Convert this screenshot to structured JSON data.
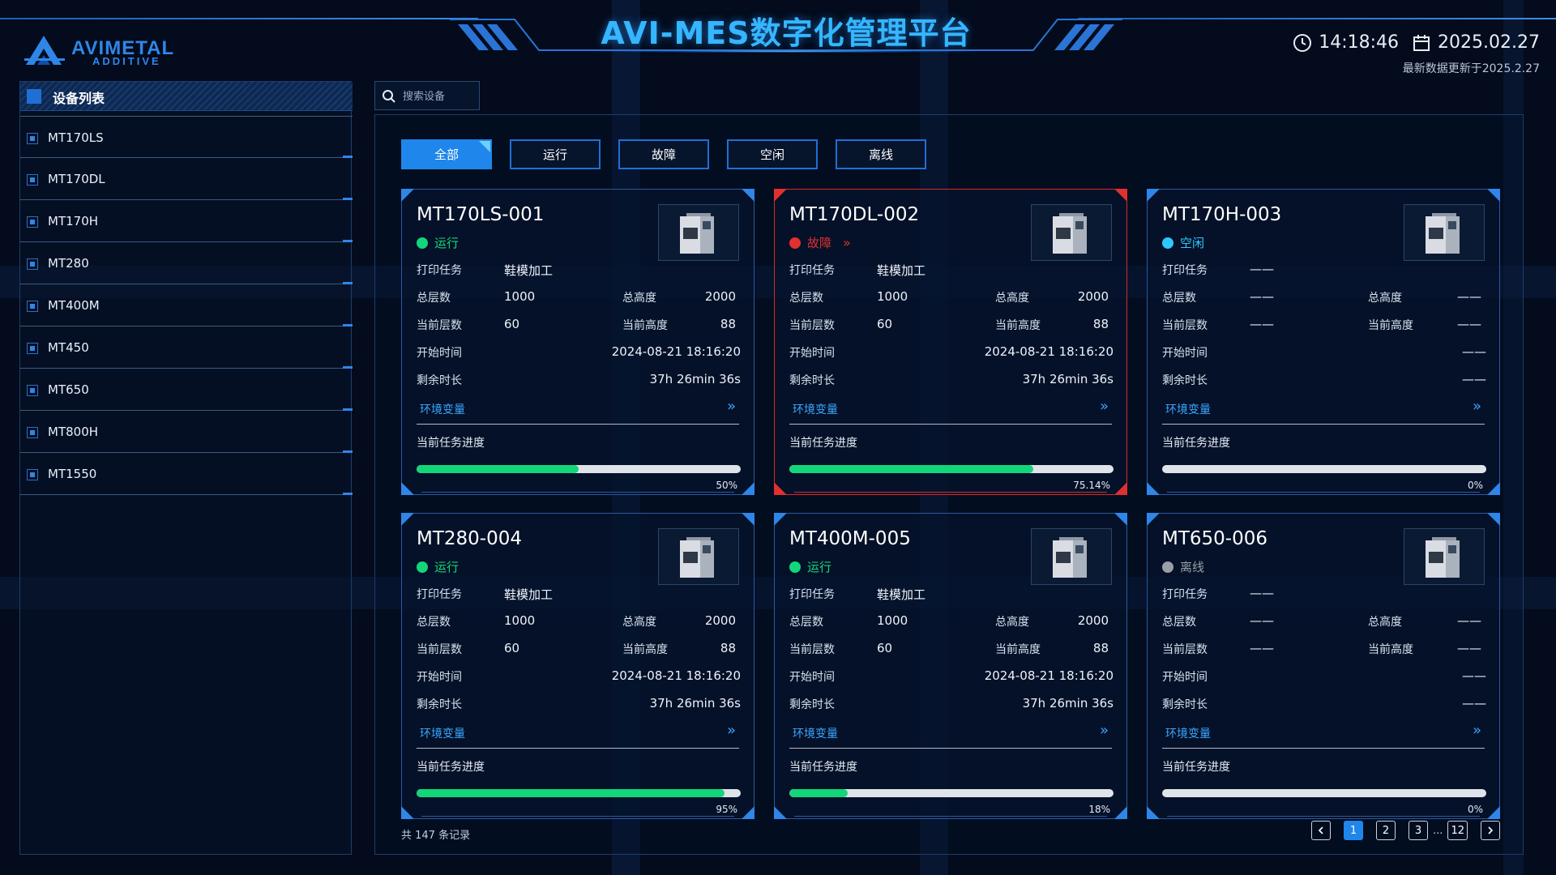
{
  "app": {
    "title": "AVI-MES数字化管理平台",
    "logo_main": "AVIMETAL",
    "logo_sub": "ADDITIVE"
  },
  "clock": {
    "time": "14:18:46",
    "date": "2025.02.27",
    "update_note": "最新数据更新于2025.2.27"
  },
  "sidebar": {
    "title": "设备列表",
    "items": [
      "MT170LS",
      "MT170DL",
      "MT170H",
      "MT280",
      "MT400M",
      "MT450",
      "MT650",
      "MT800H",
      "MT1550"
    ]
  },
  "search": {
    "placeholder": "搜索设备"
  },
  "filters": [
    "全部",
    "运行",
    "故障",
    "空闲",
    "离线"
  ],
  "labels": {
    "task": "打印任务",
    "total_layers": "总层数",
    "total_height": "总高度",
    "current_layer": "当前层数",
    "current_height": "当前高度",
    "start_time": "开始时间",
    "remaining": "剩余时长",
    "env": "环境变量",
    "progress": "当前任务进度"
  },
  "cards": [
    {
      "id": "MT170LS-001",
      "status": "运行",
      "status_color": "#12d67a",
      "task": "鞋模加工",
      "total_layers": "1000",
      "total_height": "2000",
      "current_layer": "60",
      "current_height": "88",
      "start_time": "2024-08-21 18:16:20",
      "remaining": "37h 26min 36s",
      "progress": 50,
      "progress_text": "50%"
    },
    {
      "id": "MT170DL-002",
      "status": "故障",
      "status_color": "#e23030",
      "task": "鞋模加工",
      "total_layers": "1000",
      "total_height": "2000",
      "current_layer": "60",
      "current_height": "88",
      "start_time": "2024-08-21 18:16:20",
      "remaining": "37h 26min 36s",
      "progress": 75.14,
      "progress_text": "75.14%"
    },
    {
      "id": "MT170H-003",
      "status": "空闲",
      "status_color": "#2ec8ff",
      "task": "——",
      "total_layers": "——",
      "total_height": "——",
      "current_layer": "——",
      "current_height": "——",
      "start_time": "——",
      "remaining": "——",
      "progress": 0,
      "progress_text": "0%"
    },
    {
      "id": "MT280-004",
      "status": "运行",
      "status_color": "#12d67a",
      "task": "鞋模加工",
      "total_layers": "1000",
      "total_height": "2000",
      "current_layer": "60",
      "current_height": "88",
      "start_time": "2024-08-21 18:16:20",
      "remaining": "37h 26min 36s",
      "progress": 95,
      "progress_text": "95%"
    },
    {
      "id": "MT400M-005",
      "status": "运行",
      "status_color": "#12d67a",
      "task": "鞋模加工",
      "total_layers": "1000",
      "total_height": "2000",
      "current_layer": "60",
      "current_height": "88",
      "start_time": "2024-08-21 18:16:20",
      "remaining": "37h 26min 36s",
      "progress": 18,
      "progress_text": "18%"
    },
    {
      "id": "MT650-006",
      "status": "离线",
      "status_color": "#9a9fa6",
      "task": "——",
      "total_layers": "——",
      "total_height": "——",
      "current_layer": "——",
      "current_height": "——",
      "start_time": "——",
      "remaining": "——",
      "progress": 0,
      "progress_text": "0%"
    }
  ],
  "footer": {
    "total": "共 147 条记录",
    "pages": [
      "1",
      "2",
      "3"
    ],
    "dots": "...",
    "last_page": "12"
  },
  "icons": {
    "clock": "clock-icon",
    "calendar": "calendar-icon",
    "search": "search-icon",
    "prev": "chevron-left-icon",
    "next": "chevron-right-icon",
    "env": "double-chevron-right-icon"
  }
}
